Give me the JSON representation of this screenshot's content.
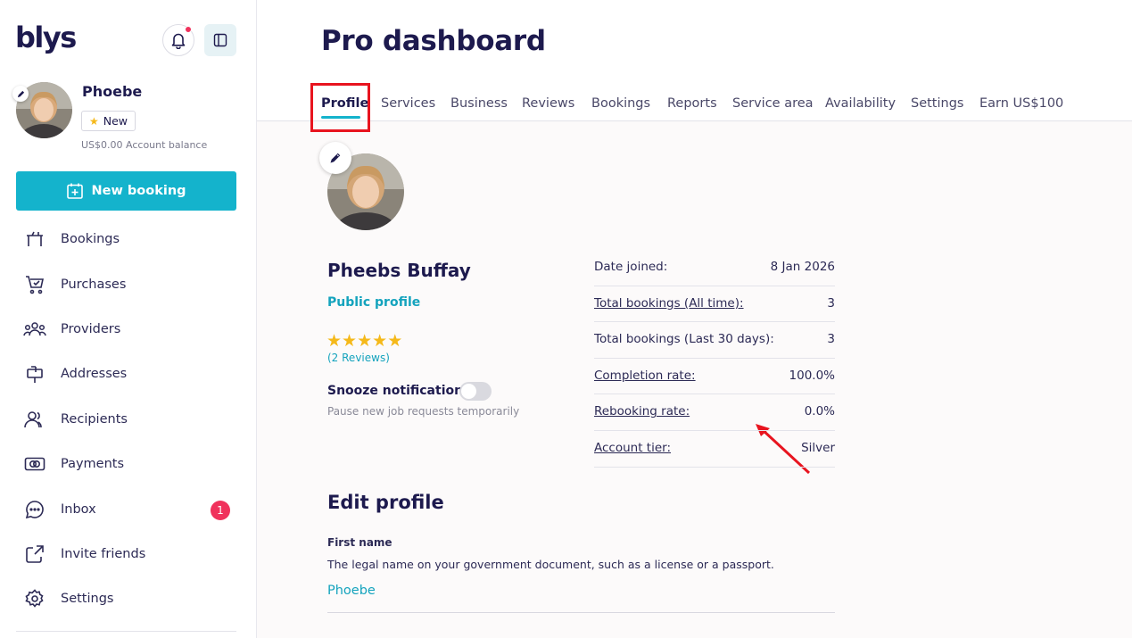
{
  "sidebar": {
    "logo": "blys",
    "user": {
      "name": "Phoebe",
      "badge": "New",
      "balance": "US$0.00 Account balance"
    },
    "new_booking_label": "New booking",
    "nav": [
      {
        "label": "Bookings",
        "icon": "bookings-icon"
      },
      {
        "label": "Purchases",
        "icon": "cart-icon"
      },
      {
        "label": "Providers",
        "icon": "providers-icon"
      },
      {
        "label": "Addresses",
        "icon": "mailbox-icon"
      },
      {
        "label": "Recipients",
        "icon": "recipients-icon"
      },
      {
        "label": "Payments",
        "icon": "payments-icon"
      },
      {
        "label": "Inbox",
        "icon": "chat-icon",
        "badge": "1"
      },
      {
        "label": "Invite friends",
        "icon": "share-icon"
      },
      {
        "label": "Settings",
        "icon": "gear-icon"
      }
    ]
  },
  "main": {
    "title": "Pro dashboard",
    "tabs": [
      {
        "label": "Profile",
        "active": true
      },
      {
        "label": "Services"
      },
      {
        "label": "Business"
      },
      {
        "label": "Reviews"
      },
      {
        "label": "Bookings"
      },
      {
        "label": "Reports"
      },
      {
        "label": "Service area"
      },
      {
        "label": "Availability"
      },
      {
        "label": "Settings"
      },
      {
        "label": "Earn US$100"
      }
    ],
    "profile": {
      "name": "Pheebs Buffay",
      "public_profile_label": "Public profile",
      "rating_stars": 5,
      "reviews_label": "(2 Reviews)",
      "snooze_label": "Snooze notifications",
      "snooze_on": false,
      "snooze_help": "Pause new job requests temporarily"
    },
    "stats": [
      {
        "key": "Date joined:",
        "value": "8 Jan 2026",
        "link": false
      },
      {
        "key": "Total bookings (All time):",
        "value": "3",
        "link": true
      },
      {
        "key": "Total bookings (Last 30 days):",
        "value": "3",
        "link": false
      },
      {
        "key": "Completion rate:",
        "value": "100.0%",
        "link": true
      },
      {
        "key": "Rebooking rate:",
        "value": "0.0%",
        "link": true
      },
      {
        "key": "Account tier:",
        "value": "Silver",
        "link": true
      }
    ],
    "edit_profile": {
      "title": "Edit profile",
      "first_name_label": "First name",
      "first_name_help": "The legal name on your government document, such as a license or a passport.",
      "first_name_value": "Phoebe"
    }
  },
  "colors": {
    "accent": "#14b3cc",
    "brand_dark": "#1d1a4e",
    "badge_red": "#f0325c",
    "highlight": "#e8141f",
    "star": "#f5b91a"
  }
}
